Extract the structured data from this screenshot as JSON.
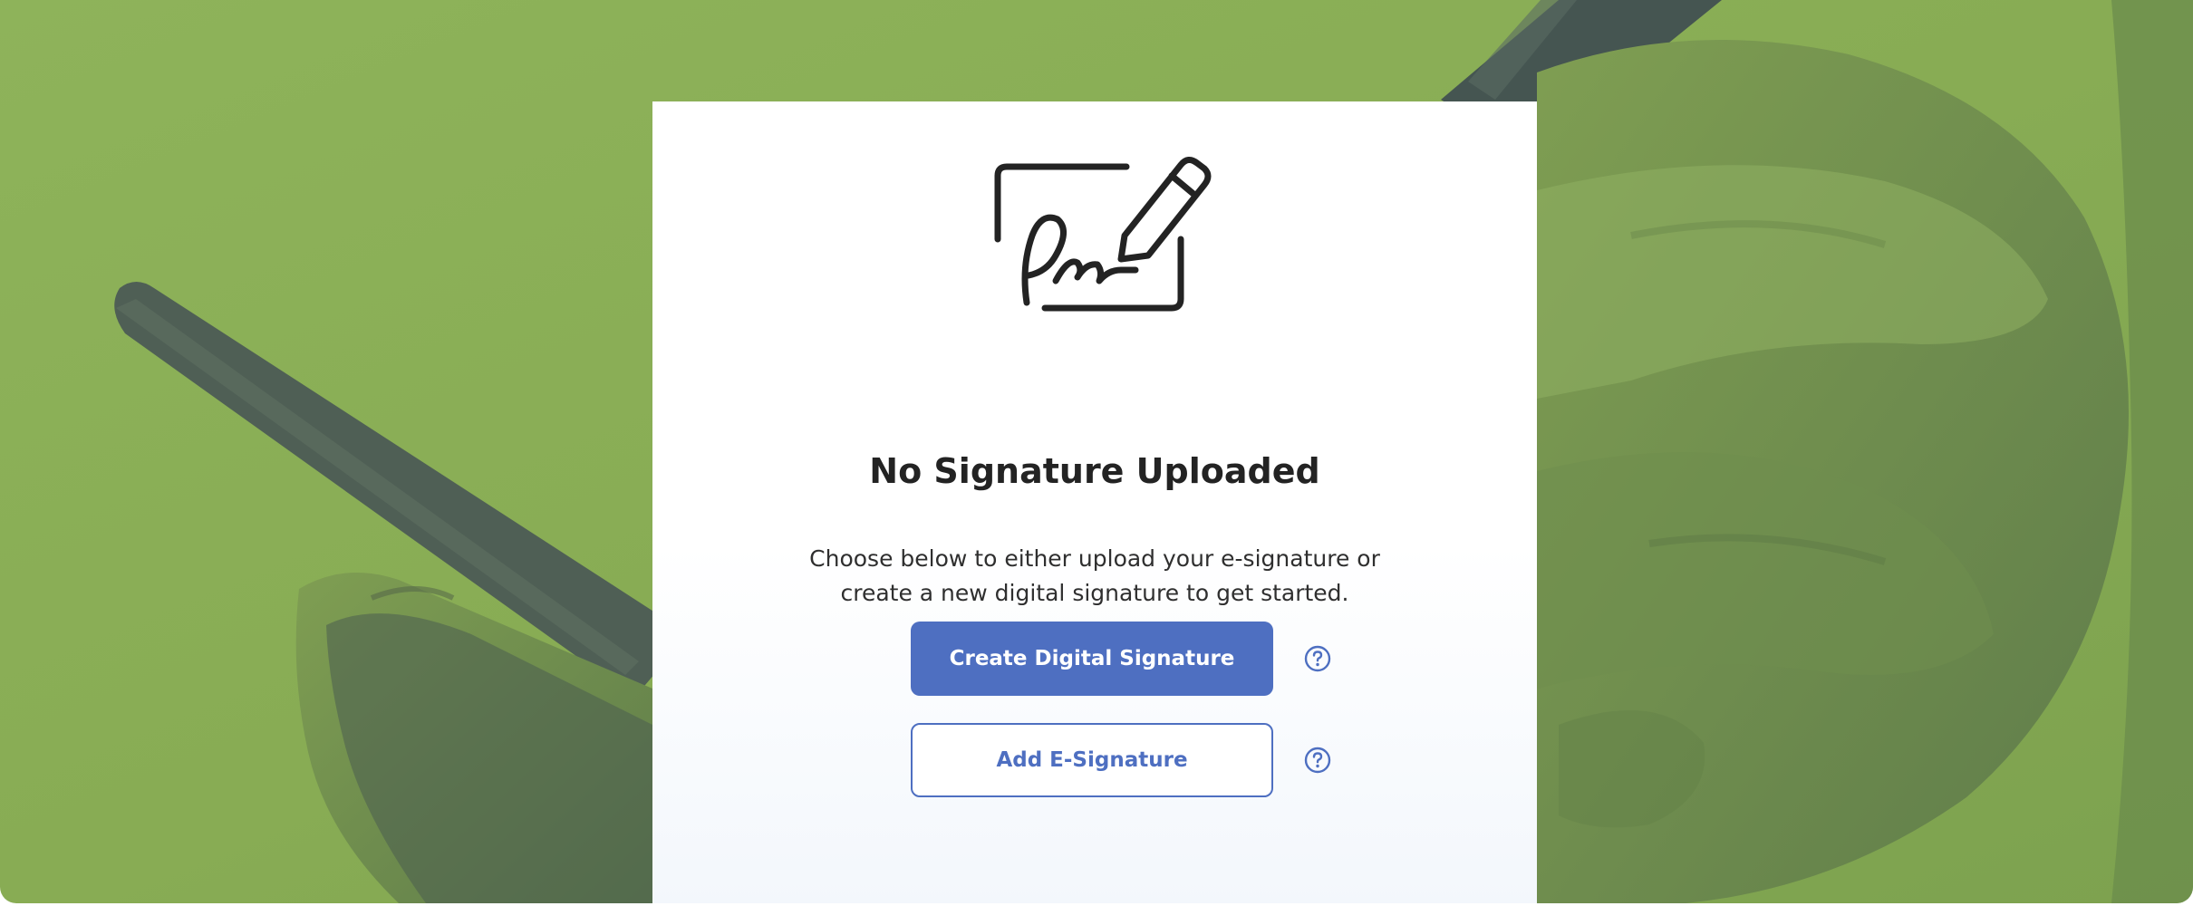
{
  "card": {
    "title": "No Signature Uploaded",
    "description_line1": "Choose below to either upload your e-signature or",
    "description_line2": "create a new digital signature to get started."
  },
  "actions": {
    "create_label": "Create Digital Signature",
    "add_label": "Add E-Signature"
  },
  "icons": {
    "illustration": "signature-pen-icon",
    "help": "help-circle-icon"
  },
  "colors": {
    "background_green": "#8aae58",
    "accent_blue": "#4e6fc1",
    "title_text": "#232323"
  }
}
